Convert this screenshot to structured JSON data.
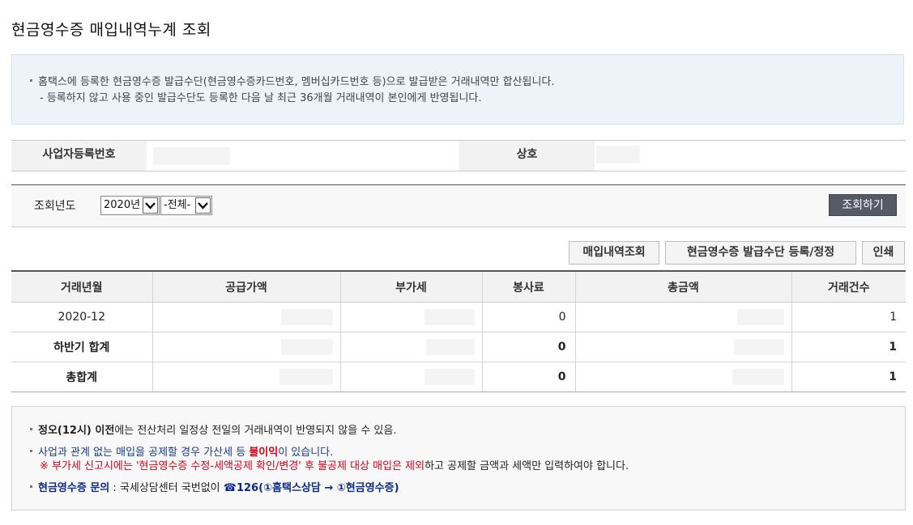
{
  "page_title": "현금영수증 매입내역누계 조회",
  "info": {
    "line1": "홈택스에 등록한 현금영수증 발급수단(현금영수증카드번호, 멤버십카드번호 등)으로 발급받은 거래내역만 합산됩니다.",
    "line2": "-  등록하지 않고 사용 중인 발급수단도 등록한 다음 날 최근 36개월 거래내역이 본인에게 반영됩니다."
  },
  "business": {
    "reg_no_label": "사업자등록번호",
    "name_label": "상호"
  },
  "search": {
    "label": "조회년도",
    "year_value": "2020년",
    "period_value": "-전체-",
    "submit_label": "조회하기"
  },
  "actions": {
    "purchase_lookup": "매입내역조회",
    "register_receipt_method": "현금영수증 발급수단 등록/정정",
    "print": "인쇄"
  },
  "table": {
    "headers": [
      "거래년월",
      "공급가액",
      "부가세",
      "봉사료",
      "총금액",
      "거래건수"
    ],
    "rows": [
      {
        "month": "2020-12",
        "service": "0",
        "count": "1"
      },
      {
        "month": "하반기 합계",
        "service": "0",
        "count": "1"
      },
      {
        "month": "총합계",
        "service": "0",
        "count": "1"
      }
    ]
  },
  "notice": {
    "n1_bold": "정오(12시) 이전",
    "n1_rest": "에는 전산처리 일정상 전일의 거래내역이 반영되지 않을 수 있음.",
    "n2_pre": "사업과 관계 없는 매입을 공제할 경우 가산세 등 ",
    "n2_bold": "불이익",
    "n2_post": "이 있습니다.",
    "n3_red": "※ 부가세 신고시에는 '현금영수증 수정-세액공제 확인/변경' 후 불공제 대상 매입은 제외",
    "n3_rest": "하고 공제할 금액과 세액만 입력하여야 합니다.",
    "n4_label": "현금영수증 문의",
    "n4_mid": " : 국세상담센터 국번없이 ",
    "n4_phone": "☎126(①홈택스상담 → ①현금영수증)"
  }
}
